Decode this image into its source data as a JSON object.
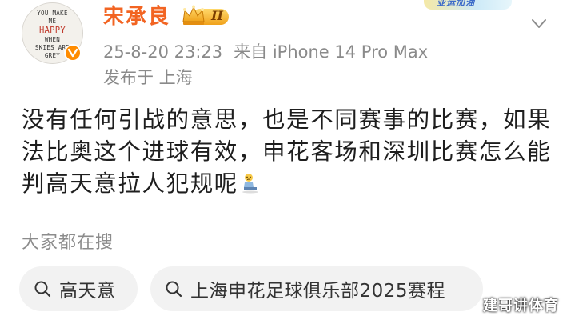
{
  "post": {
    "author": {
      "name": "宋承良",
      "avatar_text": [
        "YOU MAKE",
        "ME",
        "HAPPY",
        "WHEN",
        "SKIES ARE",
        "GREY"
      ],
      "vip_level": "II"
    },
    "date": "25-8-20 23:23",
    "source": "来自 iPhone 14 Pro Max",
    "location": "发布于 上海",
    "content_lines": [
      "没有任何引战的意思，也是不同赛事的比赛，如果",
      "法比奥这个进球有效，申花客场和深圳比赛怎么能",
      "判高天意拉人犯规呢"
    ]
  },
  "top_banner": {
    "text": "亚运加油"
  },
  "trending": {
    "title": "大家都在搜",
    "items": [
      {
        "label": "高天意"
      },
      {
        "label": "上海申花足球俱乐部2025赛程"
      }
    ]
  },
  "watermark": {
    "text": "建哥讲体育"
  },
  "colors": {
    "name": "#f26422",
    "meta": "#8a8a8a",
    "chip_bg": "#f2f2f2",
    "verified": "#ff8c00"
  }
}
